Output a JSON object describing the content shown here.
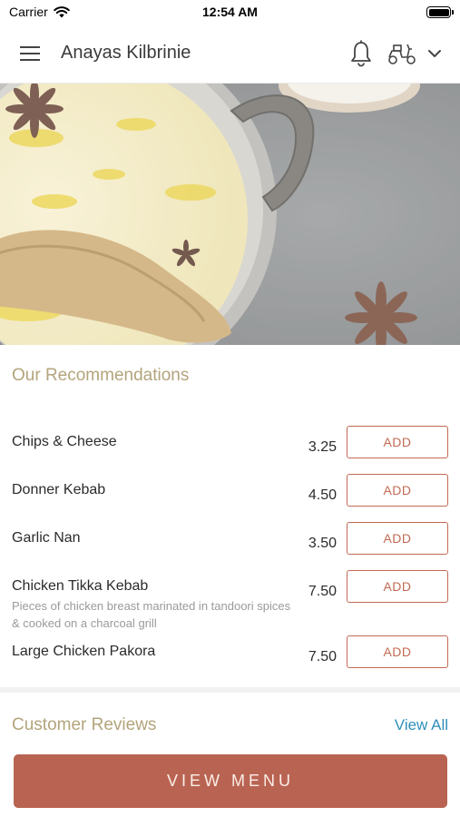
{
  "status_bar": {
    "carrier": "Carrier",
    "time": "12:54 AM",
    "icons": [
      "wifi-icon",
      "battery-icon"
    ]
  },
  "header": {
    "title": "Anayas Kilbrinie",
    "icons": [
      "hamburger-menu-icon",
      "bell-icon",
      "scooter-delivery-icon",
      "chevron-down-icon"
    ]
  },
  "hero": {
    "description_icon": "biryani-food-photo"
  },
  "recommendations": {
    "title": "Our Recommendations",
    "items": [
      {
        "name": "Chips & Cheese",
        "description": "",
        "price": "3.25",
        "button": "ADD"
      },
      {
        "name": "Donner Kebab",
        "description": "",
        "price": "4.50",
        "button": "ADD"
      },
      {
        "name": "Garlic Nan",
        "description": "",
        "price": "3.50",
        "button": "ADD"
      },
      {
        "name": "Chicken Tikka Kebab",
        "description": "Pieces of chicken breast marinated in tandoori spices & cooked on a charcoal grill",
        "price": "7.50",
        "button": "ADD"
      },
      {
        "name": "Large Chicken Pakora",
        "description": "",
        "price": "7.50",
        "button": "ADD"
      }
    ]
  },
  "reviews": {
    "title": "Customer Reviews",
    "view_all": "View All"
  },
  "footer": {
    "view_menu": "VIEW MENU"
  },
  "colors": {
    "accent": "#b96452",
    "section_title": "#b3a47c",
    "link": "#2f8fb9"
  }
}
